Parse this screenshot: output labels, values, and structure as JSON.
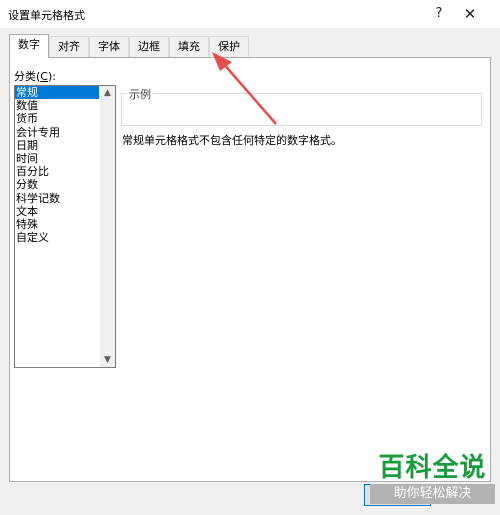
{
  "dialog": {
    "title": "设置单元格格式",
    "help_glyph": "?",
    "close_glyph": "✕"
  },
  "tabs": [
    {
      "label": "数字",
      "active": true
    },
    {
      "label": "对齐",
      "active": false
    },
    {
      "label": "字体",
      "active": false
    },
    {
      "label": "边框",
      "active": false
    },
    {
      "label": "填充",
      "active": false
    },
    {
      "label": "保护",
      "active": false
    }
  ],
  "number_page": {
    "category_label_prefix": "分类(",
    "category_label_key": "C",
    "category_label_suffix": "):",
    "categories": [
      "常规",
      "数值",
      "货币",
      "会计专用",
      "日期",
      "时间",
      "百分比",
      "分数",
      "科学记数",
      "文本",
      "特殊",
      "自定义"
    ],
    "selected_index": 0,
    "sample_legend": "示例",
    "description": "常规单元格格式不包含任何特定的数字格式。"
  },
  "watermark": {
    "main": "百科全说",
    "sub": "助你轻松解决"
  },
  "colors": {
    "selection": "#0078d7",
    "annotation_arrow": "#e84c4c",
    "watermark_green": "#1a9b3c"
  },
  "icons": {
    "help": "help-icon",
    "close": "close-icon",
    "scroll_up": "scroll-up-arrow-icon",
    "scroll_down": "scroll-down-arrow-icon"
  }
}
